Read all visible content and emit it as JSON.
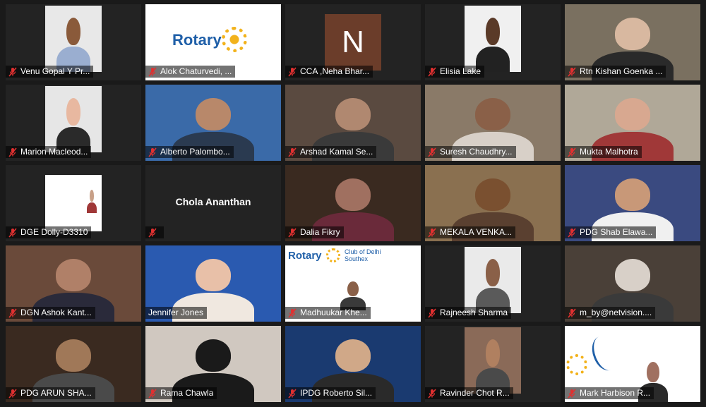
{
  "participants": [
    {
      "name": "Venu Gopal Y Pr...",
      "type": "photo",
      "bg": "#e8e8e8",
      "skin": "#8a5a3a",
      "shirt": "#9aaed0"
    },
    {
      "name": "Alok Chaturvedi, ...",
      "type": "rotary-logo",
      "logo_text": "Rotary"
    },
    {
      "name": "CCA ,Neha Bhar...",
      "type": "initial",
      "initial": "N"
    },
    {
      "name": "Elisia Lake",
      "type": "photo",
      "bg": "#f0f0f0",
      "skin": "#5a3a28",
      "shirt": "#222222"
    },
    {
      "name": "Rtn Kishan Goenka ...",
      "type": "video",
      "bg": "#7a7060",
      "skin": "#d8b8a0",
      "shirt": "#2a2a2a"
    },
    {
      "name": "Marion Macleod...",
      "type": "photo",
      "bg": "#e6e6e6",
      "skin": "#e8b8a0",
      "shirt": "#2a2a2a"
    },
    {
      "name": "Alberto Palombo...",
      "type": "video",
      "bg": "#3a6aa8",
      "skin": "#b8886a",
      "shirt": "#2a3a50"
    },
    {
      "name": "Arshad Kamal Se...",
      "type": "video",
      "bg": "#5a4a40",
      "skin": "#b08870",
      "shirt": "#3a3a3a"
    },
    {
      "name": "Suresh Chaudhry...",
      "type": "video",
      "bg": "#8a7a68",
      "skin": "#8a6048",
      "shirt": "#d8d0c8"
    },
    {
      "name": "Mukta Malhotra",
      "type": "video",
      "bg": "#b0a898",
      "skin": "#d8a890",
      "shirt": "#a03838"
    },
    {
      "name": "DGE Dolly-D3310",
      "type": "slide",
      "bg": "#ffffff"
    },
    {
      "name": "Chola Ananthan",
      "type": "name-only",
      "display": "Chola Ananthan"
    },
    {
      "name": "Dalia Fikry",
      "type": "video",
      "bg": "#3a2a20",
      "skin": "#a07060",
      "shirt": "#6a2a3a"
    },
    {
      "name": "MEKALA VENKA...",
      "type": "video",
      "bg": "#8a7050",
      "skin": "#7a5030",
      "shirt": "#5a4030"
    },
    {
      "name": "PDG Shab Elawa...",
      "type": "video",
      "bg": "#3a4a80",
      "skin": "#c89878",
      "shirt": "#f0f0f0"
    },
    {
      "name": "DGN Ashok Kant...",
      "type": "video",
      "bg": "#6a4a3a",
      "skin": "#b08068",
      "shirt": "#2a2a3a"
    },
    {
      "name": "Jennifer Jones",
      "type": "video",
      "bg": "#2a5ab0",
      "skin": "#e8c0a8",
      "shirt": "#f0e8e0",
      "active": true
    },
    {
      "name": "Madhuukar Khe...",
      "type": "rotary-slide",
      "logo_text": "Rotary",
      "club": "Club of Delhi Southex"
    },
    {
      "name": "Rajneesh Sharma",
      "type": "photo",
      "bg": "#eaeaea",
      "skin": "#8a6048",
      "shirt": "#5a5a5a"
    },
    {
      "name": "m_by@netvision....",
      "type": "video",
      "bg": "#4a4038",
      "skin": "#d8d0c8",
      "shirt": "#3a3a3a"
    },
    {
      "name": "PDG  ARUN SHA...",
      "type": "video",
      "bg": "#3a2a20",
      "skin": "#a07858",
      "shirt": "#4a4a4a"
    },
    {
      "name": "Rama Chawla",
      "type": "video",
      "bg": "#d0c8c0",
      "skin": "#1a1a1a",
      "shirt": "#1a1a1a"
    },
    {
      "name": "IPDG Roberto Sil...",
      "type": "video",
      "bg": "#1a3a70",
      "skin": "#d0a888",
      "shirt": "#2a2a2a"
    },
    {
      "name": "Ravinder Chot R...",
      "type": "photo",
      "bg": "#8a6a58",
      "skin": "#b08060",
      "shirt": "#4a4a4a"
    },
    {
      "name": "Mark Harbison R...",
      "type": "rotary-action",
      "bg": "#ffffff",
      "skin": "#a07060",
      "shirt": "#2a2a2a"
    }
  ]
}
